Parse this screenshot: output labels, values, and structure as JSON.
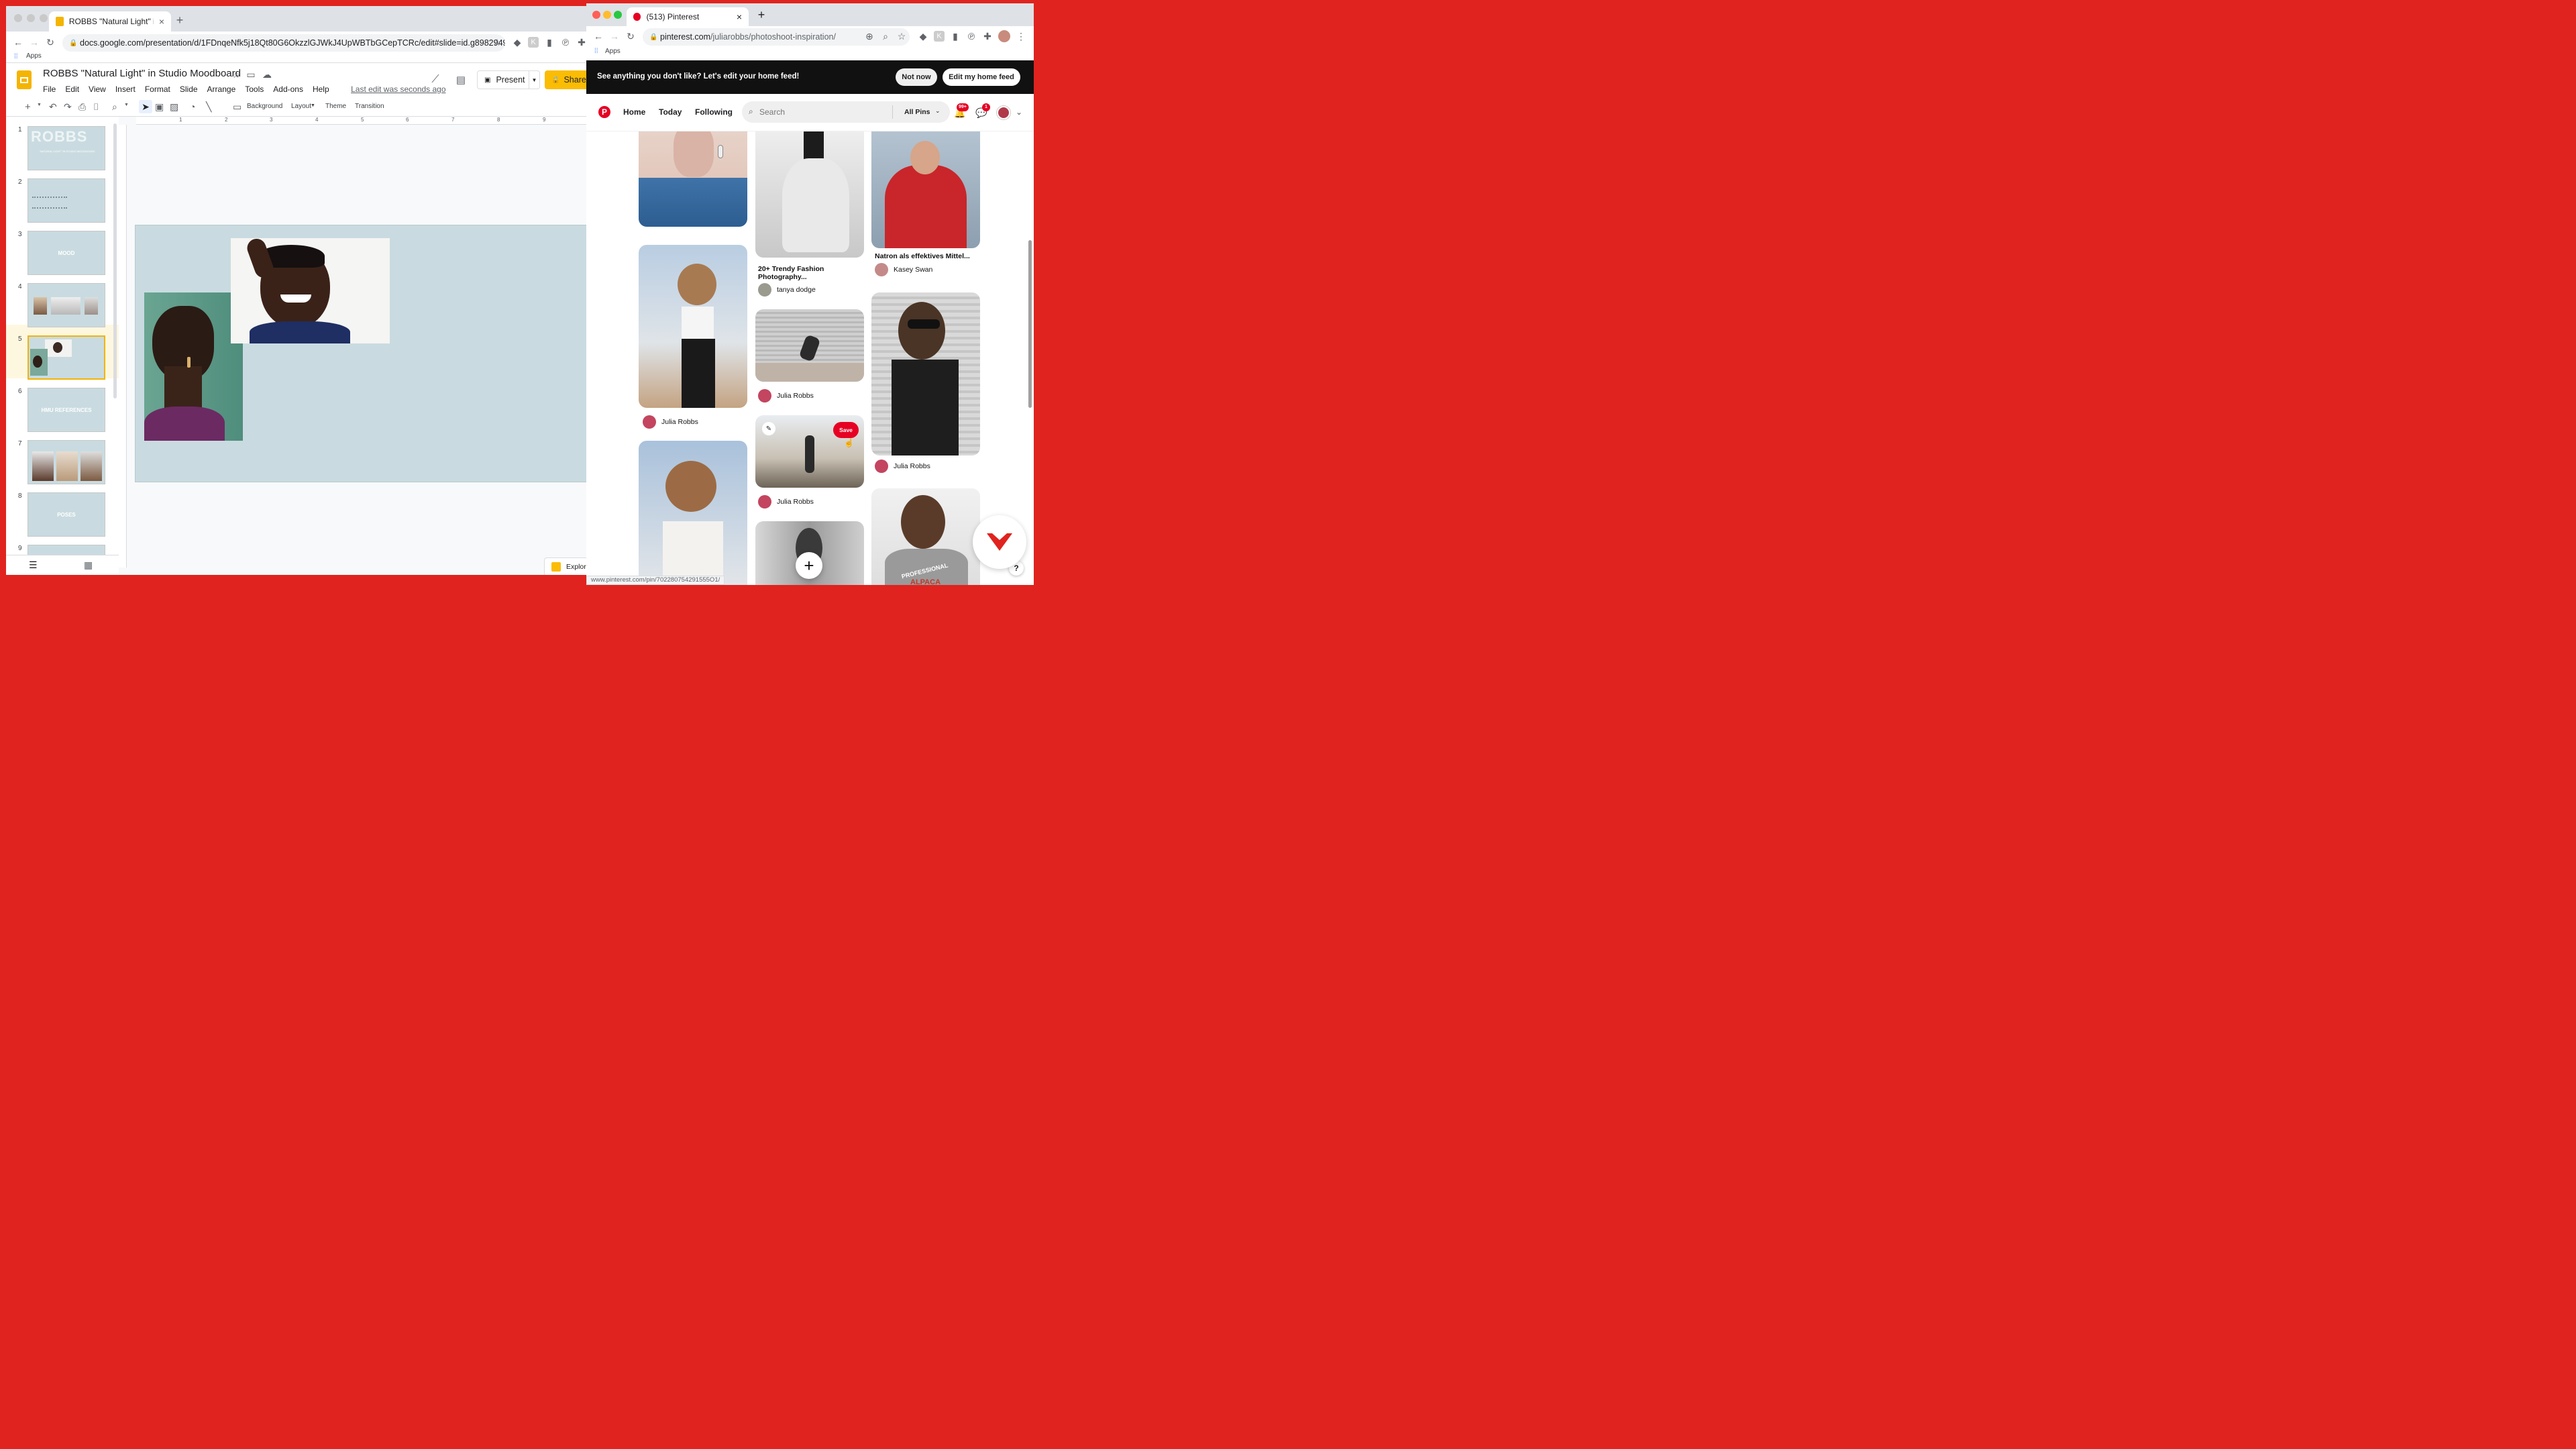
{
  "docs": {
    "tab_title": "ROBBS \"Natural Light\" in Studio",
    "url": "docs.google.com/presentation/d/1FDnqeNfk5j18Qt80G6OkzzlGJWkJ4UpWBTbGCepTCRc/edit#slide=id.g8982949fcd_...",
    "bookmarks_apps": "Apps",
    "doc_title": "ROBBS \"Natural Light\" in Studio Moodboard",
    "menus": [
      "File",
      "Edit",
      "View",
      "Insert",
      "Format",
      "Slide",
      "Arrange",
      "Tools",
      "Add-ons",
      "Help"
    ],
    "last_edit": "Last edit was seconds ago",
    "present_label": "Present",
    "share_label": "Share",
    "toolbar": {
      "background": "Background",
      "layout": "Layout",
      "theme": "Theme",
      "transition": "Transition"
    },
    "ruler_numbers": [
      "1",
      "2",
      "3",
      "4",
      "5",
      "6",
      "7",
      "8",
      "9"
    ],
    "slide_numbers": [
      "1",
      "2",
      "3",
      "4",
      "5",
      "6",
      "7",
      "8",
      "9"
    ],
    "thumb_texts": {
      "s1_title": "ROBBS",
      "s1_sub": "\"NATURAL LIGHT\" IN STUDIO MOODBOARD",
      "s3": "MOOD",
      "s6": "HMU REFERENCES",
      "s8": "POSES"
    },
    "explore_label": "Explore",
    "current_slide": 5
  },
  "pinterest": {
    "tab_title": "(513) Pinterest",
    "url_host": "pinterest.com",
    "url_path": "/juliarobbs/photoshoot-inspiration/",
    "bookmarks_apps": "Apps",
    "banner_text": "See anything you don't like? Let's edit your home feed!",
    "not_now": "Not now",
    "edit_feed": "Edit my home feed",
    "nav": {
      "home": "Home",
      "today": "Today",
      "following": "Following"
    },
    "search_placeholder": "Search",
    "all_pins": "All Pins",
    "notif_badge": "99+",
    "msg_badge": "1",
    "pin_titles": {
      "fashion": "20+ Trendy Fashion Photography...",
      "natron": "Natron als effektives Mittel..."
    },
    "pinners": {
      "tanya": "tanya dodge",
      "kasey": "Kasey Swan",
      "julia": "Julia Robbs"
    },
    "save_label": "Save",
    "tshirt_text": "PROFESSIONAL",
    "tshirt_text2": "ALPACA",
    "status_url": "www.pinterest.com/pin/702280754291555O1/"
  },
  "colors": {
    "pinterest_red": "#e60023",
    "share_yellow": "#fbbc04",
    "slide_bg": "#c9dbe0",
    "desktop_red": "#e0231e"
  }
}
